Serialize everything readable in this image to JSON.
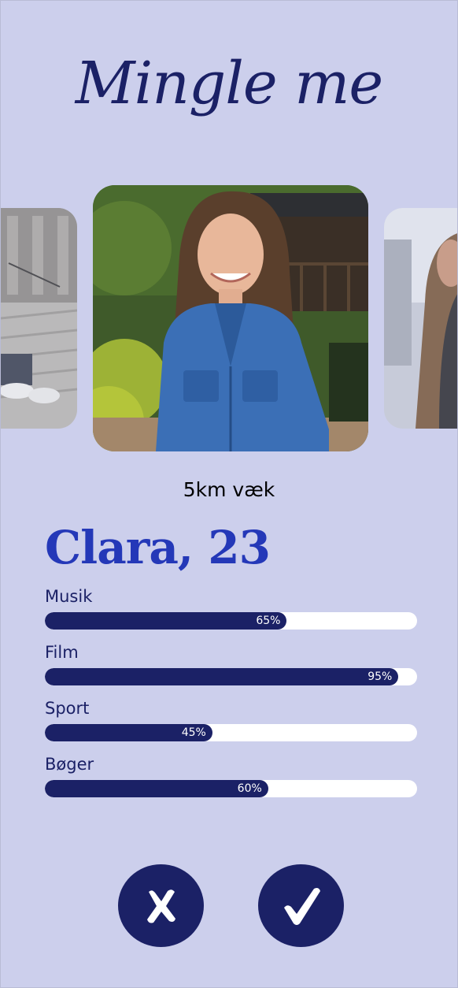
{
  "app": {
    "title": "Mingle me"
  },
  "profile": {
    "distance": "5km væk",
    "name_age": "Clara, 23"
  },
  "interests": [
    {
      "label": "Musik",
      "value": 65,
      "display": "65%"
    },
    {
      "label": "Film",
      "value": 95,
      "display": "95%"
    },
    {
      "label": "Sport",
      "value": 45,
      "display": "45%"
    },
    {
      "label": "Bøger",
      "value": 60,
      "display": "60%"
    }
  ],
  "actions": {
    "reject_icon": "close-icon",
    "accept_icon": "checkmark-icon"
  },
  "colors": {
    "background": "#cccfec",
    "primary": "#1b2166",
    "accent_name": "#2438b8",
    "bar_track": "#ffffff"
  }
}
